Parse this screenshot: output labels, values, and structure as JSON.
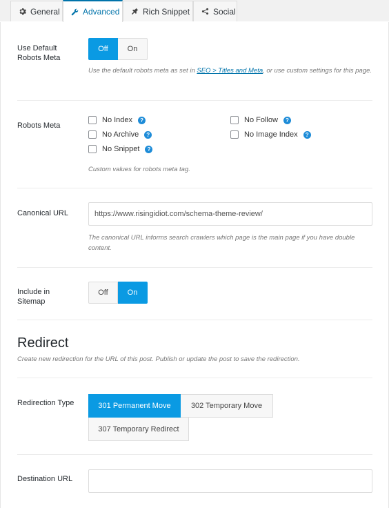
{
  "tabs": [
    {
      "label": "General",
      "icon": "gear-icon"
    },
    {
      "label": "Advanced",
      "icon": "wrench-icon",
      "active": true
    },
    {
      "label": "Rich Snippet",
      "icon": "pin-icon"
    },
    {
      "label": "Social",
      "icon": "share-icon"
    }
  ],
  "robots_default": {
    "label": "Use Default Robots Meta",
    "off": "Off",
    "on": "On",
    "selected": "Off",
    "desc_pre": "Use the default robots meta as set in ",
    "desc_link": "SEO > Titles and Meta",
    "desc_post": ", or use custom settings for this page."
  },
  "robots_meta": {
    "label": "Robots Meta",
    "options": {
      "no_index": "No Index",
      "no_archive": "No Archive",
      "no_snippet": "No Snippet",
      "no_follow": "No Follow",
      "no_image_index": "No Image Index"
    },
    "help": "?",
    "desc": "Custom values for robots meta tag."
  },
  "canonical": {
    "label": "Canonical URL",
    "value": "https://www.risingidiot.com/schema-theme-review/",
    "desc": "The canonical URL informs search crawlers which page is the main page if you have double content."
  },
  "sitemap": {
    "label": "Include in Sitemap",
    "off": "Off",
    "on": "On",
    "selected": "On"
  },
  "redirect": {
    "title": "Redirect",
    "desc": "Create new redirection for the URL of this post. Publish or update the post to save the redirection.",
    "type_label": "Redirection Type",
    "types": [
      "301 Permanent Move",
      "302 Temporary Move",
      "307 Temporary Redirect"
    ],
    "selected": "301 Permanent Move",
    "destination_label": "Destination URL",
    "destination_value": ""
  },
  "colors": {
    "accent": "#0a9ae3",
    "link": "#0073aa"
  }
}
